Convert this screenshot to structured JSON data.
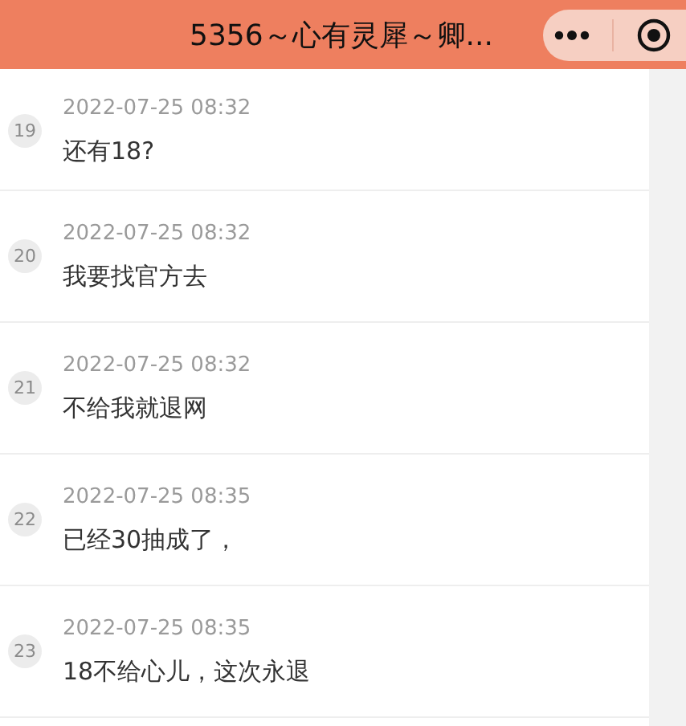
{
  "window": {
    "title": "5356～心有灵犀～卿..."
  },
  "comments": [
    {
      "number": "19",
      "time": "2022-07-25 08:32",
      "text": "还有18?"
    },
    {
      "number": "20",
      "time": "2022-07-25 08:32",
      "text": "我要找官方去"
    },
    {
      "number": "21",
      "time": "2022-07-25 08:32",
      "text": "不给我就退网"
    },
    {
      "number": "22",
      "time": "2022-07-25 08:35",
      "text": "已经30抽成了，"
    },
    {
      "number": "23",
      "time": "2022-07-25 08:35",
      "text": "18不给心儿，这次永退"
    }
  ]
}
